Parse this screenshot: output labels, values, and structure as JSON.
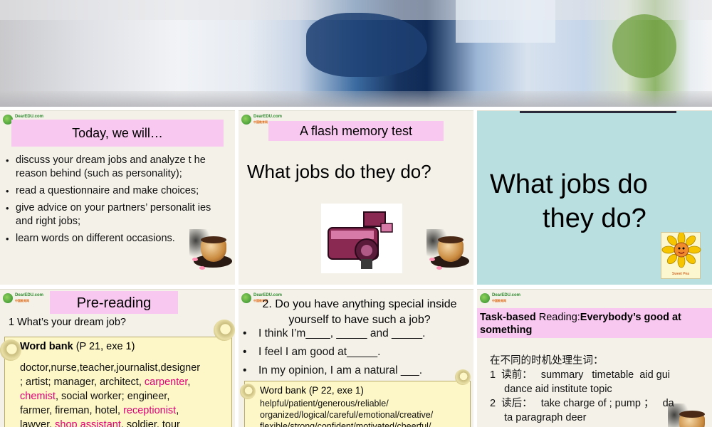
{
  "panel1": {
    "title": "Today, we will…",
    "items": [
      "discuss your dream jobs and analyze t he reason behind (such as personality);",
      "read a questionnaire and make choices;",
      "give advice on your partners’ personalit ies and right jobs;",
      "learn words on different occasions."
    ]
  },
  "panel2": {
    "title": "A flash memory test",
    "question": "What jobs do they do?",
    "image": "camera-clipart"
  },
  "panel3": {
    "line1": "What jobs do",
    "line2": "they do?",
    "image": "sunflower-clipart",
    "image_caption": "Sweet Pea"
  },
  "panel4": {
    "title": "Pre-reading",
    "question": "1  What’s your dream job?",
    "wordbank_label": "Word bank",
    "wordbank_ref": "(P 21, exe 1)",
    "words_line1": "doctor,nurse,teacher,journalist,designer",
    "words_line2a": "; artist; manager, architect,  ",
    "words_carpenter": "carpenter",
    "words_line2b": ",",
    "words_chemist": "chemist",
    "words_line3": ", social worker; engineer,",
    "words_line4a": "farmer, fireman, hotel, ",
    "words_receptionist": "receptionist",
    "words_line4b": ",",
    "words_line5a": "lawyer,  ",
    "words_shop": "shop assistant",
    "words_line5b": ", soldier, tour"
  },
  "panel5": {
    "question": "2.  Do you have anything special inside yourself to have such a job?",
    "items": [
      "I think I’m____, _____ and _____.",
      "I feel I am good at_____.",
      "In my opinion, I am a natural ___."
    ],
    "wordbank_label": "Word bank",
    "wordbank_ref": "(P 22, exe 1)",
    "words": "helpful/patient/generous/reliable/ organized/logical/careful/emotional/creative/ flexible/strong/confident/motivated/cheerful/"
  },
  "panel6": {
    "tb_prefix": "Task-based ",
    "tb_mid": "Reading:",
    "tb_bold": "Everybody’s good at something",
    "line1": "在不同的时机处理生词：",
    "line2": "1  读前：   summary   timetable  aid gui",
    "line3": "     dance aid institute topic",
    "line4": "2  读后：   take charge of ; pump ；   da",
    "line5": "     ta paragraph deer"
  },
  "colors": {
    "title_box": "#f8c8f0",
    "panel_bg": "#f3f1e8",
    "panel3_bg": "#b9dfe0",
    "highlight": "#e0007a",
    "scroll": "#fdf6c6"
  }
}
